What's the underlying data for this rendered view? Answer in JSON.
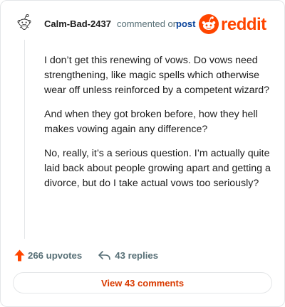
{
  "comment": {
    "username": "Calm-Bad-2437",
    "action_text": "commented on",
    "post_link_label": "post",
    "brand_name": "reddit",
    "paragraphs": [
      "I don’t get this renewing of vows. Do vows need strengthening, like magic spells which otherwise wear off unless reinforced by a competent wizard?",
      "And when they got broken before, how they hell makes vowing again any difference?",
      "No, really, it’s a serious question. I’m actually quite laid back about people growing apart and getting a divorce, but do I take actual vows too seriously?"
    ],
    "upvotes_label": "266 upvotes",
    "replies_label": "43 replies",
    "view_comments_label": "View 43 comments"
  },
  "colors": {
    "brand": "#ff4500",
    "link": "#0a449b",
    "meta": "#576f76",
    "button_text": "#d93a00"
  },
  "icons": {
    "avatar": "snoo-avatar-icon",
    "logo": "reddit-logo-icon",
    "upvote": "upvote-arrow-icon",
    "reply": "reply-arrow-icon"
  }
}
